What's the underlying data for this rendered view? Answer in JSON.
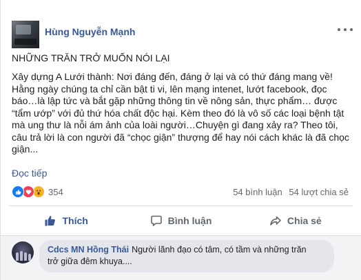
{
  "post": {
    "author": "Hùng Nguyễn Mạnh",
    "title": "NHỮNG TRĂN TRỞ MUỐN NÓI LẠI",
    "body_lines": [
      "Xây dựng A Lưới thành: Nơi đáng đến, đáng ở lại và có thứ đáng mang về!",
      "Hằng ngày chúng ta chỉ cần bật ti vi, lên mạng intenet, lướt facebook, đọc",
      "báo…là lập tức và bắt gặp những thông tin về nông sản, thực phẩm… được",
      "“tẩm ướp” với đủ thứ hóa chất độc hại. Kèm theo đó là vô số các loại bệnh tật",
      "mà ung thư là nỗi ám ảnh của loài người…Chuyện gì đang xảy ra? Theo tôi,",
      "câu trả lời là con người đã “chọc giận” thượng để hay nói cách khác là đã chọc",
      "giận..."
    ],
    "read_more": "Đọc tiếp"
  },
  "stats": {
    "reaction_count": "354",
    "comments": "54 bình luận",
    "shares": "54 lượt chia sẻ"
  },
  "actions": {
    "like_label": "Thích",
    "comment_label": "Bình luận",
    "share_label": "Chia sẻ"
  },
  "comment": {
    "author": "Cdcs MN Hồng Thái",
    "text_line1": "Người lãnh đạo có tâm, có tầm và những trăn",
    "text_line2": "trở giữa đêm khuya...."
  },
  "icons": {
    "like": "like-icon",
    "love": "love-icon",
    "wow": "wow-icon",
    "comment": "comment-icon",
    "share": "share-icon",
    "more": "more-options-icon"
  },
  "colors": {
    "link": "#385898",
    "like_blue": "#1877f2",
    "love_red": "#f33e58",
    "wow_yellow": "#f7b125"
  }
}
